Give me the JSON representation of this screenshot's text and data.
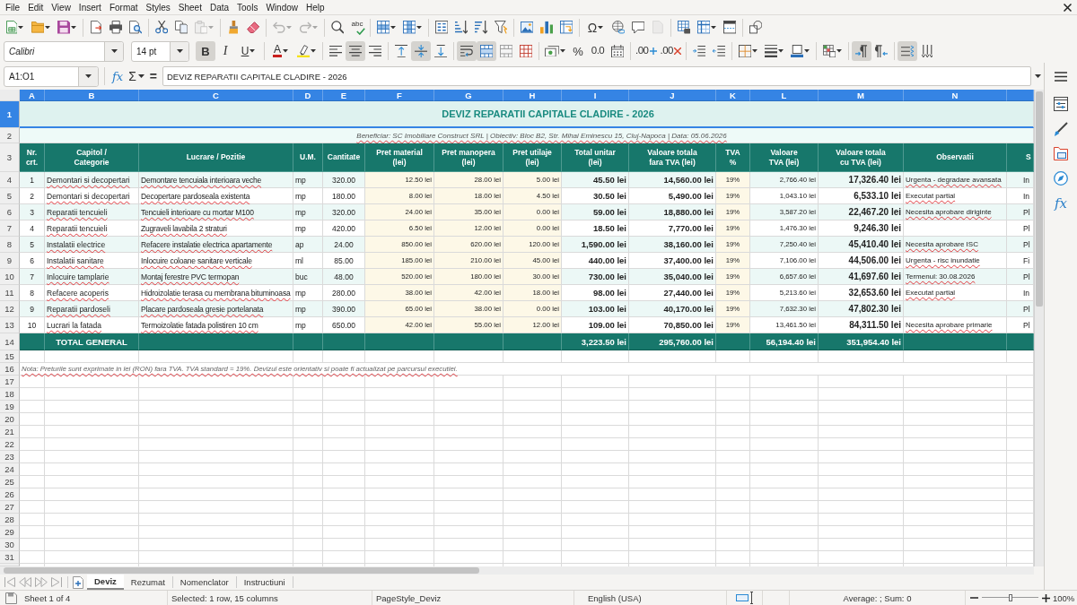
{
  "menu_bar": {
    "items": [
      "File",
      "Edit",
      "View",
      "Insert",
      "Format",
      "Styles",
      "Sheet",
      "Data",
      "Tools",
      "Window",
      "Help"
    ]
  },
  "standard_toolbar": {
    "buttons": [
      {
        "disabled": false
      },
      {
        "disabled": false
      },
      {
        "disabled": false
      },
      {
        "disabled": false
      },
      {
        "disabled": false
      },
      {
        "disabled": false
      },
      {
        "disabled": false
      },
      {
        "disabled": false
      },
      {
        "disabled": true
      },
      {
        "disabled": false
      },
      {
        "disabled": false
      },
      {
        "disabled": true
      },
      {
        "disabled": true
      },
      {
        "disabled": false
      },
      {
        "glyph": "abc",
        "disabled": false
      },
      {
        "disabled": false
      },
      {
        "disabled": false
      },
      {
        "disabled": false
      },
      {
        "disabled": false
      },
      {
        "disabled": false
      },
      {
        "disabled": false
      },
      {
        "disabled": false
      },
      {
        "disabled": false
      },
      {
        "disabled": false
      },
      {
        "glyph": "Ω",
        "disabled": false
      },
      {
        "disabled": false
      },
      {
        "disabled": false
      },
      {
        "disabled": true
      },
      {
        "disabled": false
      },
      {
        "disabled": false
      },
      {
        "disabled": false
      },
      {
        "disabled": false
      }
    ]
  },
  "formatting_toolbar": {
    "font_name": "Calibri",
    "font_size": "14 pt",
    "buttons": [
      {
        "glyph": "B",
        "pressed": true
      },
      {
        "glyph": "I",
        "pressed": false
      },
      {
        "glyph": "U",
        "pressed": false
      },
      {
        "glyph": "A",
        "pressed": false
      },
      {
        "pressed": false
      },
      {
        "pressed": false
      },
      {
        "pressed": true
      },
      {
        "pressed": false
      },
      {
        "pressed": false
      },
      {
        "pressed": true
      },
      {
        "pressed": false
      },
      {
        "pressed": true
      },
      {
        "pressed": true
      },
      {
        "pressed": false
      },
      {
        "pressed": false
      },
      {
        "pressed": false
      },
      {
        "glyph": "%",
        "pressed": false
      },
      {
        "glyph": "0.0",
        "pressed": false
      },
      {
        "pressed": false
      },
      {
        "glyph": ".00",
        "pressed": false
      },
      {
        "glyph": ".00",
        "pressed": false
      },
      {
        "pressed": false
      },
      {
        "pressed": false
      },
      {
        "pressed": false
      },
      {
        "pressed": false
      },
      {
        "pressed": false
      },
      {
        "pressed": false
      },
      {
        "pressed": true
      },
      {
        "pressed": false
      },
      {
        "pressed": true
      },
      {
        "pressed": false
      }
    ]
  },
  "formula_bar": {
    "name_box": "A1:O1",
    "function_wizard": "fx",
    "sum": "Σ",
    "equals": "=",
    "content": "DEVIZ REPARATII CAPITALE CLADIRE - 2026"
  },
  "sheet": {
    "column_headers": [
      {
        "label": "A",
        "selected": true
      },
      {
        "label": "B",
        "selected": true
      },
      {
        "label": "C",
        "selected": true
      },
      {
        "label": "D",
        "selected": true
      },
      {
        "label": "E",
        "selected": true
      },
      {
        "label": "F",
        "selected": true
      },
      {
        "label": "G",
        "selected": true
      },
      {
        "label": "H",
        "selected": true
      },
      {
        "label": "I",
        "selected": true
      },
      {
        "label": "J",
        "selected": true
      },
      {
        "label": "K",
        "selected": true
      },
      {
        "label": "L",
        "selected": true
      },
      {
        "label": "M",
        "selected": true
      },
      {
        "label": "N",
        "selected": true
      },
      {
        "selected": true
      }
    ],
    "row_headers": [
      {
        "label": "1",
        "selected": true
      },
      {
        "label": "2",
        "selected": false
      },
      {
        "label": "3",
        "selected": false
      },
      {
        "label": "4",
        "selected": false
      },
      {
        "label": "5",
        "selected": false
      },
      {
        "label": "6",
        "selected": false
      },
      {
        "label": "7",
        "selected": false
      },
      {
        "label": "8",
        "selected": false
      },
      {
        "label": "9",
        "selected": false
      },
      {
        "label": "10",
        "selected": false
      },
      {
        "label": "11",
        "selected": false
      },
      {
        "label": "12",
        "selected": false
      },
      {
        "label": "13",
        "selected": false
      },
      {
        "label": "14",
        "selected": false
      },
      {
        "label": "15",
        "selected": false
      },
      {
        "label": "16",
        "selected": false
      },
      {
        "label": "17",
        "selected": false
      },
      {
        "label": "18",
        "selected": false
      },
      {
        "label": "19",
        "selected": false
      },
      {
        "label": "20",
        "selected": false
      },
      {
        "label": "21",
        "selected": false
      },
      {
        "label": "22",
        "selected": false
      },
      {
        "label": "23",
        "selected": false
      },
      {
        "label": "24",
        "selected": false
      },
      {
        "label": "25",
        "selected": false
      },
      {
        "label": "26",
        "selected": false
      },
      {
        "label": "27",
        "selected": false
      },
      {
        "label": "28",
        "selected": false
      },
      {
        "label": "29",
        "selected": false
      },
      {
        "label": "30",
        "selected": false
      },
      {
        "label": "31",
        "selected": false
      }
    ],
    "title": "DEVIZ REPARATII CAPITALE CLADIRE - 2026",
    "info": "Beneficiar: SC Imobiliare Construct SRL  |  Obiectiv: Bloc B2, Str. Mihai Eminescu 15, Cluj-Napoca  |  Data: 05.06.2026",
    "columns": [
      "Nr.\ncrt.",
      "Capitol /\nCategorie",
      "Lucrare / Pozitie",
      "U.M.",
      "Cantitate",
      "Pret material\n(lei)",
      "Pret manopera\n(lei)",
      "Pret utilaje\n(lei)",
      "Total unitar\n(lei)",
      "Valoare totala\nfara TVA (lei)",
      "TVA\n%",
      "Valoare\nTVA (lei)",
      "Valoare totala\ncu TVA (lei)",
      "Observatii",
      "S"
    ],
    "rows": [
      {
        "nr": "1",
        "capitol": "Demontari si decopertari",
        "lucrare": "Demontare tencuiala interioara veche",
        "um": "mp",
        "cantitate": "320.00",
        "pret_material": "12.50 lei",
        "pret_manopera": "28.00 lei",
        "pret_utilaje": "5.00 lei",
        "total_unitar": "45.50 lei",
        "valoare_fara_tva": "14,560.00 lei",
        "tva": "19%",
        "valoare_tva": "2,766.40 lei",
        "valoare_cu_tva": "17,326.40 lei",
        "observatii": "Urgenta - degradare avansata",
        "column_15": "In"
      },
      {
        "nr": "2",
        "capitol": "Demontari si decopertari",
        "lucrare": "Decopertare pardoseala existenta",
        "um": "mp",
        "cantitate": "180.00",
        "pret_material": "8.00 lei",
        "pret_manopera": "18.00 lei",
        "pret_utilaje": "4.50 lei",
        "total_unitar": "30.50 lei",
        "valoare_fara_tva": "5,490.00 lei",
        "tva": "19%",
        "valoare_tva": "1,043.10 lei",
        "valoare_cu_tva": "6,533.10 lei",
        "observatii": "Executat partial",
        "column_15": "In"
      },
      {
        "nr": "3",
        "capitol": "Reparatii tencuieli",
        "lucrare": "Tencuieli interioare cu mortar M100",
        "um": "mp",
        "cantitate": "320.00",
        "pret_material": "24.00 lei",
        "pret_manopera": "35.00 lei",
        "pret_utilaje": "0.00 lei",
        "total_unitar": "59.00 lei",
        "valoare_fara_tva": "18,880.00 lei",
        "tva": "19%",
        "valoare_tva": "3,587.20 lei",
        "valoare_cu_tva": "22,467.20 lei",
        "observatii": "Necesita aprobare diriginte",
        "column_15": "Pl"
      },
      {
        "nr": "4",
        "capitol": "Reparatii tencuieli",
        "lucrare": "Zugraveli lavabila 2 straturi",
        "um": "mp",
        "cantitate": "420.00",
        "pret_material": "6.50 lei",
        "pret_manopera": "12.00 lei",
        "pret_utilaje": "0.00 lei",
        "total_unitar": "18.50 lei",
        "valoare_fara_tva": "7,770.00 lei",
        "tva": "19%",
        "valoare_tva": "1,476.30 lei",
        "valoare_cu_tva": "9,246.30 lei",
        "column_15": "Pl"
      },
      {
        "nr": "5",
        "capitol": "Instalatii electrice",
        "lucrare": "Refacere instalatie electrica apartamente",
        "um": "ap",
        "cantitate": "24.00",
        "pret_material": "850.00 lei",
        "pret_manopera": "620.00 lei",
        "pret_utilaje": "120.00 lei",
        "total_unitar": "1,590.00 lei",
        "valoare_fara_tva": "38,160.00 lei",
        "tva": "19%",
        "valoare_tva": "7,250.40 lei",
        "valoare_cu_tva": "45,410.40 lei",
        "observatii": "Necesita aprobare ISC",
        "column_15": "Pl"
      },
      {
        "nr": "6",
        "capitol": "Instalatii sanitare",
        "lucrare": "Inlocuire coloane sanitare verticale",
        "um": "ml",
        "cantitate": "85.00",
        "pret_material": "185.00 lei",
        "pret_manopera": "210.00 lei",
        "pret_utilaje": "45.00 lei",
        "total_unitar": "440.00 lei",
        "valoare_fara_tva": "37,400.00 lei",
        "tva": "19%",
        "valoare_tva": "7,106.00 lei",
        "valoare_cu_tva": "44,506.00 lei",
        "observatii": "Urgenta - risc inundatie",
        "column_15": "Fi"
      },
      {
        "nr": "7",
        "capitol": "Inlocuire tamplarie",
        "lucrare": "Montaj ferestre PVC termopan",
        "um": "buc",
        "cantitate": "48.00",
        "pret_material": "520.00 lei",
        "pret_manopera": "180.00 lei",
        "pret_utilaje": "30.00 lei",
        "total_unitar": "730.00 lei",
        "valoare_fara_tva": "35,040.00 lei",
        "tva": "19%",
        "valoare_tva": "6,657.60 lei",
        "valoare_cu_tva": "41,697.60 lei",
        "observatii": "Termenul: 30.08.2026",
        "column_15": "Pl"
      },
      {
        "nr": "8",
        "capitol": "Refacere acoperis",
        "lucrare": "Hidroizolatie terasa cu membrana bituminoasa",
        "um": "mp",
        "cantitate": "280.00",
        "pret_material": "38.00 lei",
        "pret_manopera": "42.00 lei",
        "pret_utilaje": "18.00 lei",
        "total_unitar": "98.00 lei",
        "valoare_fara_tva": "27,440.00 lei",
        "tva": "19%",
        "valoare_tva": "5,213.60 lei",
        "valoare_cu_tva": "32,653.60 lei",
        "observatii": "Executat partial",
        "column_15": "In"
      },
      {
        "nr": "9",
        "capitol": "Reparatii pardoseli",
        "lucrare": "Placare pardoseala gresie portelanata",
        "um": "mp",
        "cantitate": "390.00",
        "pret_material": "65.00 lei",
        "pret_manopera": "38.00 lei",
        "pret_utilaje": "0.00 lei",
        "total_unitar": "103.00 lei",
        "valoare_fara_tva": "40,170.00 lei",
        "tva": "19%",
        "valoare_tva": "7,632.30 lei",
        "valoare_cu_tva": "47,802.30 lei",
        "column_15": "Pl"
      },
      {
        "nr": "10",
        "capitol": "Lucrari la fatada",
        "lucrare": "Termoizolatie fatada polistiren 10 cm",
        "um": "mp",
        "cantitate": "650.00",
        "pret_material": "42.00 lei",
        "pret_manopera": "55.00 lei",
        "pret_utilaje": "12.00 lei",
        "total_unitar": "109.00 lei",
        "valoare_fara_tva": "70,850.00 lei",
        "tva": "19%",
        "valoare_tva": "13,461.50 lei",
        "valoare_cu_tva": "84,311.50 lei",
        "observatii": "Necesita aprobare primarie",
        "column_15": "Pl"
      }
    ],
    "total": {
      "label": "TOTAL GENERAL",
      "total_unitar": "3,223.50 lei",
      "valoare_fara_tva": "295,760.00 lei",
      "valoare_tva": "56,194.40 lei",
      "valoare_cu_tva": "351,954.40 lei"
    },
    "note": "Nota: Preturile sunt exprimate in lei (RON) fara TVA. TVA standard = 19%. Devizul este orientativ si poate fi actualizat pe parcursul executiei."
  },
  "sheet_tabs": [
    {
      "label": "Deviz",
      "selected": true
    },
    {
      "label": "Rezumat",
      "selected": false
    },
    {
      "label": "Nomenclator",
      "selected": false
    },
    {
      "label": "Instructiuni",
      "selected": false
    }
  ],
  "sidebar": {
    "functions": "fx"
  },
  "status_bar": {
    "sheet": "Sheet 1 of 4",
    "selection": "Selected: 1 row, 15 columns",
    "page_style": "PageStyle_Deviz",
    "language": "English (USA)",
    "summary": "Average: ; Sum: 0",
    "zoom": {
      "level": 0.5,
      "reading": "100%"
    }
  }
}
